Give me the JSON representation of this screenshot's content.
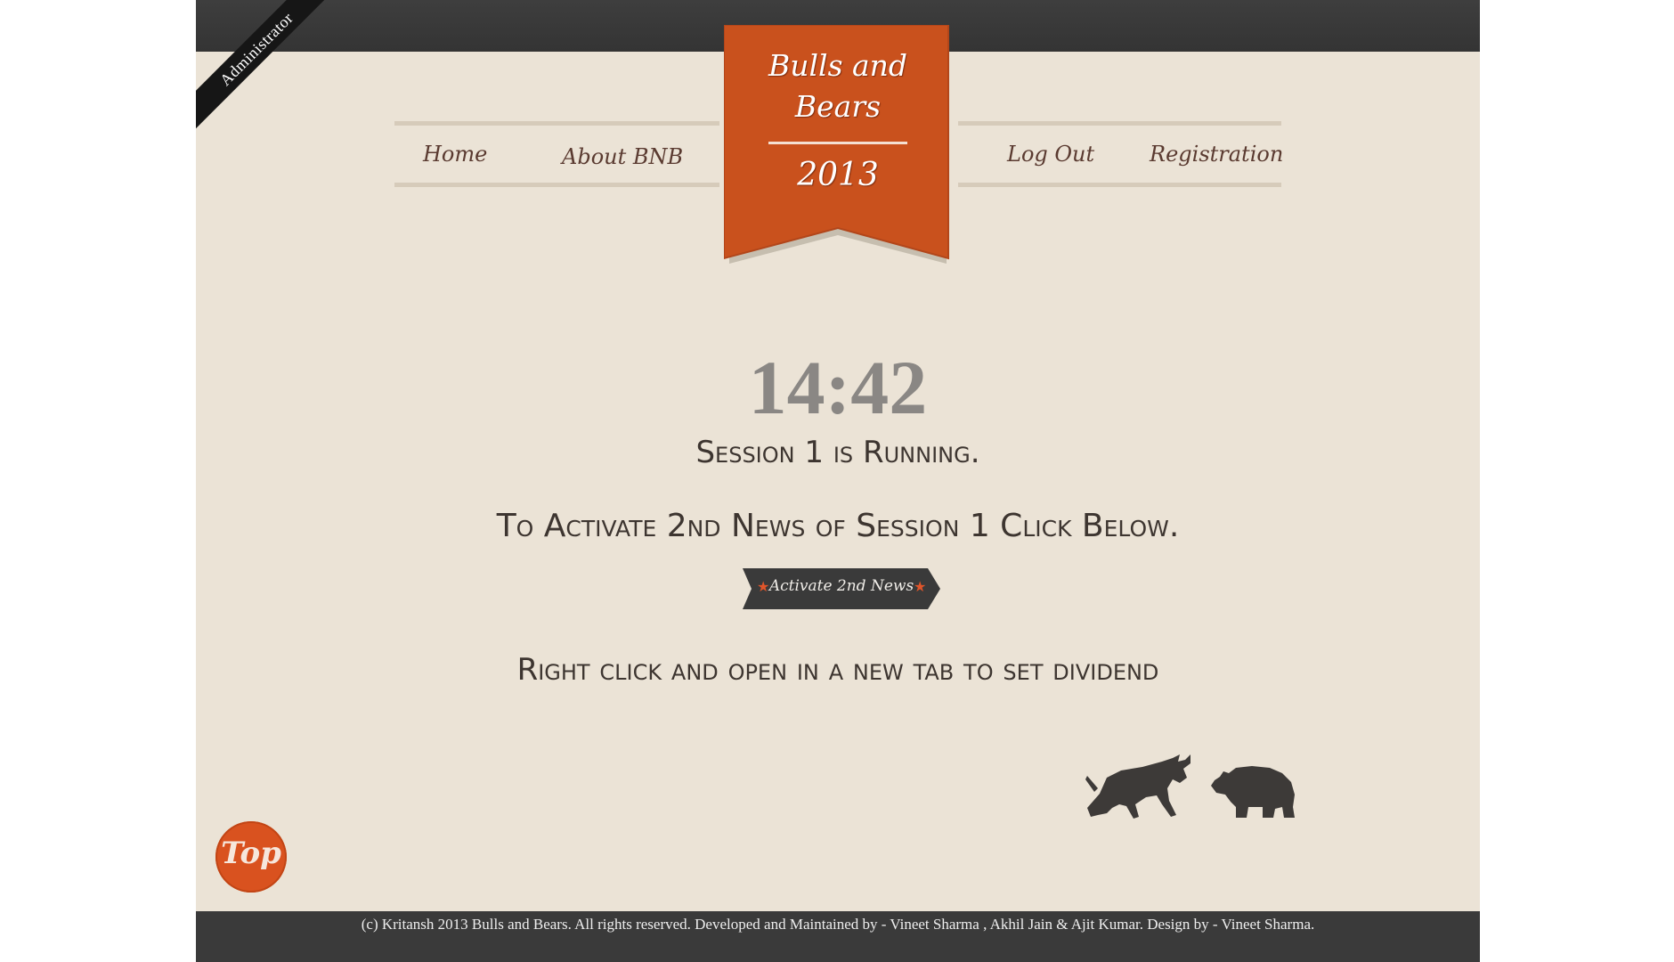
{
  "corner_ribbon": {
    "label": "Administrator"
  },
  "nav": {
    "left": [
      {
        "label": "Home"
      },
      {
        "label": "About BNB"
      }
    ],
    "right": [
      {
        "label": "Log Out"
      },
      {
        "label": "Registration"
      }
    ]
  },
  "banner": {
    "title_line1": "Bulls and",
    "title_line2": "Bears",
    "year": "2013"
  },
  "main": {
    "clock": "14:42",
    "status": "Session 1 is Running.",
    "activate_prompt": "To Activate 2nd News of Session 1 Click Below.",
    "activate_button_label": "Activate 2nd News",
    "dividend_note": "Right click and open in a new tab to set dividend"
  },
  "top_button": {
    "label": "Top"
  },
  "footer": {
    "text": "(c) Kritansh 2013 Bulls and Bears. All rights reserved. Developed and Maintained by - Vineet Sharma , Akhil Jain & Ajit Kumar. Design by - Vineet Sharma."
  },
  "icons": {
    "bull": "bull-icon",
    "bear": "bear-icon",
    "star": "star-icon"
  },
  "colors": {
    "banner_orange": "#c9511d",
    "background": "#ebe3d6",
    "dark_bar": "#3a3a3a",
    "text_dark": "#3d3530",
    "clock_gray": "#8a8784"
  }
}
